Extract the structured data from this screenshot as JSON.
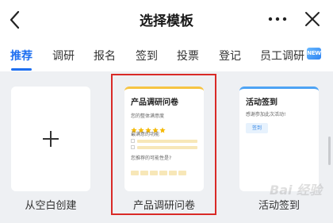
{
  "header": {
    "title": "选择模板"
  },
  "tabs": [
    {
      "label": "推荐",
      "active": true
    },
    {
      "label": "调研",
      "active": false
    },
    {
      "label": "报名",
      "active": false
    },
    {
      "label": "签到",
      "active": false
    },
    {
      "label": "投票",
      "active": false
    },
    {
      "label": "登记",
      "active": false
    },
    {
      "label": "员工调研",
      "active": false,
      "badge": "NEW"
    }
  ],
  "templates": {
    "blank": {
      "caption": "从空白创建"
    },
    "survey": {
      "caption": "产品调研问卷",
      "preview_title": "产品调研问卷",
      "q1": "您的整体满意度",
      "rating": 5,
      "q2": "最满意的功能",
      "q3": "您推荐的可能性是?"
    },
    "checkin": {
      "caption": "活动签到",
      "preview_title": "活动签到",
      "subtitle": "感谢参加此次活动!",
      "button": "签到"
    }
  },
  "watermark": "Bai 经验",
  "colors": {
    "accent": "#1e6ff0",
    "highlight": "#d92a27",
    "survey_bar": "#f6c443",
    "checkin_bar": "#4da3f4",
    "star": "#f5b800"
  }
}
